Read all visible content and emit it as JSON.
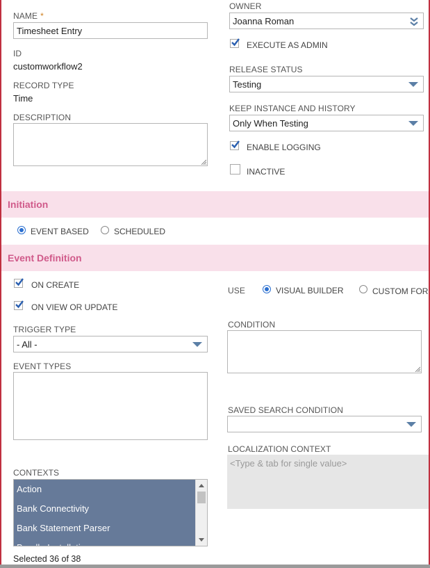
{
  "fields": {
    "name_label": "NAME",
    "name_required": "*",
    "name_value": "Timesheet Entry",
    "id_label": "ID",
    "id_value": "customworkflow2",
    "record_type_label": "RECORD TYPE",
    "record_type_value": "Time",
    "description_label": "DESCRIPTION",
    "owner_label": "OWNER",
    "owner_value": "Joanna Roman",
    "execute_as_admin_label": "EXECUTE AS ADMIN",
    "release_status_label": "RELEASE STATUS",
    "release_status_value": "Testing",
    "keep_instance_label": "KEEP INSTANCE AND HISTORY",
    "keep_instance_value": "Only When Testing",
    "enable_logging_label": "ENABLE LOGGING",
    "inactive_label": "INACTIVE"
  },
  "initiation": {
    "title": "Initiation",
    "event_based_label": "EVENT BASED",
    "scheduled_label": "SCHEDULED"
  },
  "event_definition": {
    "title": "Event Definition",
    "on_create_label": "ON CREATE",
    "on_view_update_label": "ON VIEW OR UPDATE",
    "trigger_type_label": "TRIGGER TYPE",
    "trigger_type_value": "- All -",
    "event_types_label": "EVENT TYPES",
    "contexts_label": "CONTEXTS",
    "contexts": [
      "Action",
      "Bank Connectivity",
      "Bank Statement Parser",
      "Bundle Installation"
    ],
    "selected_count": "Selected 36 of 38",
    "use_label": "USE",
    "visual_builder_label": "VISUAL BUILDER",
    "custom_formula_label": "CUSTOM FORMULA",
    "condition_label": "CONDITION",
    "saved_search_label": "SAVED SEARCH CONDITION",
    "localization_label": "LOCALIZATION CONTEXT",
    "localization_placeholder": "<Type & tab for single value>"
  },
  "colors": {
    "section_bg": "#f9e0ea",
    "section_text": "#d05a8a",
    "list_bg": "#667a99",
    "accent": "#2a6fd0"
  }
}
